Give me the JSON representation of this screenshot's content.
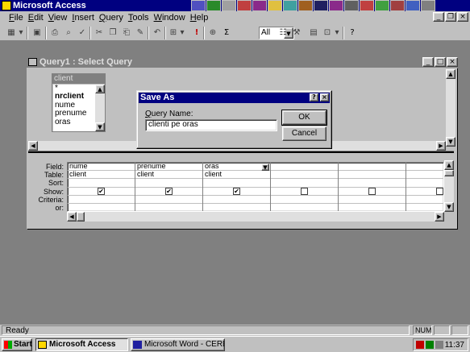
{
  "app": {
    "title": "Microsoft Access"
  },
  "menu": [
    "File",
    "Edit",
    "View",
    "Insert",
    "Query",
    "Tools",
    "Window",
    "Help"
  ],
  "toolbar": {
    "combo_value": "All",
    "sigma": "Σ",
    "run": "!"
  },
  "query_window": {
    "title": "Query1 : Select Query"
  },
  "field_list": {
    "table": "client",
    "fields": [
      "*",
      "nrclient",
      "nume",
      "prenume",
      "oras"
    ],
    "primary_key": "nrclient"
  },
  "grid": {
    "row_labels": [
      "Field:",
      "Table:",
      "Sort:",
      "Show:",
      "Criteria:",
      "or:"
    ],
    "columns": [
      {
        "field": "nume",
        "table": "client",
        "show": true
      },
      {
        "field": "prenume",
        "table": "client",
        "show": true
      },
      {
        "field": "oras",
        "table": "client",
        "show": true
      },
      {
        "field": "",
        "table": "",
        "show": false
      },
      {
        "field": "",
        "table": "",
        "show": false
      },
      {
        "field": "",
        "table": "",
        "show": false
      }
    ]
  },
  "dialog": {
    "title": "Save As",
    "label": "Query Name:",
    "value": "clienti pe oras",
    "ok": "OK",
    "cancel": "Cancel",
    "help": "?",
    "close": "×"
  },
  "status": {
    "message": "Ready",
    "num": "NUM"
  },
  "taskbar": {
    "start": "Start",
    "tasks": [
      "Microsoft Access",
      "Microsoft Word - CERERE..."
    ],
    "clock": "11:37"
  },
  "icons": {
    "checked": "✔",
    "minimize": "_",
    "maximize": "□",
    "close": "×",
    "restore": "❐",
    "arrow_up": "▲",
    "arrow_down": "▼",
    "arrow_left": "◀",
    "arrow_right": "▶"
  }
}
